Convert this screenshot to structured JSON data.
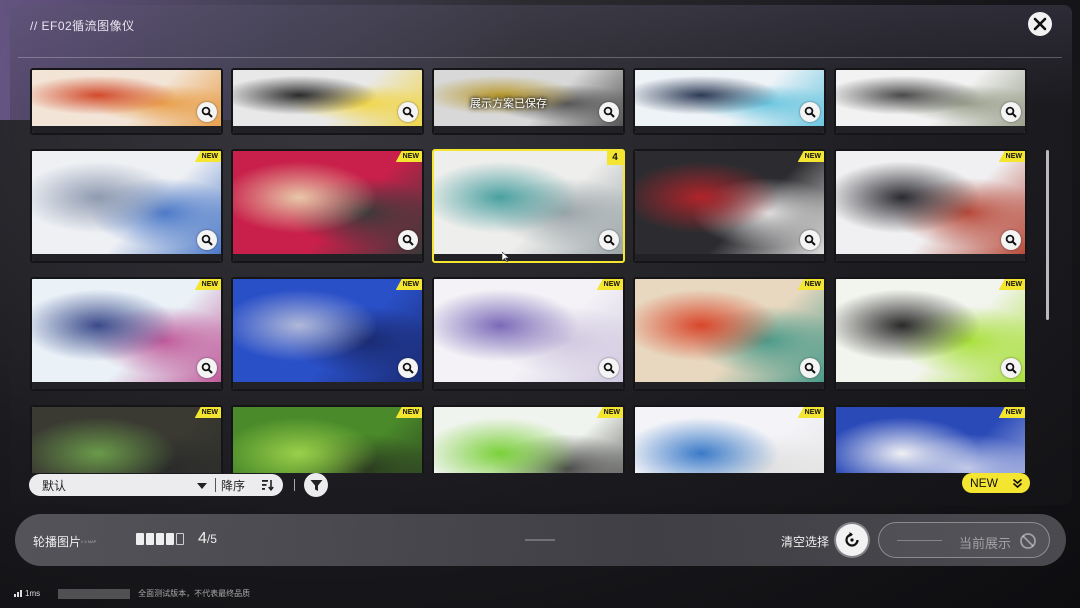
{
  "app": {
    "title": "// EF02循流图像仪"
  },
  "toast": "展示方案已保存",
  "grid": {
    "rows": [
      [
        {
          "badge": "",
          "colors": [
            "#f2e4d6",
            "#d24a2b",
            "#e9a04b"
          ]
        },
        {
          "badge": "",
          "colors": [
            "#e8e8e8",
            "#2b2b2b",
            "#f1d64a"
          ]
        },
        {
          "badge": "",
          "colors": [
            "#d8d8d8",
            "#b99a2e",
            "#555555"
          ]
        },
        {
          "badge": "",
          "colors": [
            "#eef3f7",
            "#2c3a55",
            "#6bc6e0"
          ]
        },
        {
          "badge": "",
          "colors": [
            "#f2f2f2",
            "#4a4a4a",
            "#9aa08c"
          ]
        }
      ],
      [
        {
          "badge": "NEW",
          "colors": [
            "#eef0f4",
            "#8e9ab0",
            "#4a78c8"
          ]
        },
        {
          "badge": "NEW",
          "colors": [
            "#c8204a",
            "#e8c8a8",
            "#3a3a3a"
          ]
        },
        {
          "badge": "4",
          "colors": [
            "#eeeeec",
            "#4aa0a0",
            "#9aa4a8"
          ],
          "selected": true
        },
        {
          "badge": "NEW",
          "colors": [
            "#2c2c30",
            "#b0242a",
            "#e0e0e0"
          ]
        },
        {
          "badge": "NEW",
          "colors": [
            "#f0f0f2",
            "#2a2a30",
            "#b84a3a"
          ]
        }
      ],
      [
        {
          "badge": "NEW",
          "colors": [
            "#eaf2f8",
            "#3a4a8a",
            "#c05a9a"
          ]
        },
        {
          "badge": "NEW",
          "colors": [
            "#2a50c8",
            "#b0b8d8",
            "#1a2a70"
          ]
        },
        {
          "badge": "NEW",
          "colors": [
            "#f4f2f6",
            "#7a6ab8",
            "#d0c8e0"
          ]
        },
        {
          "badge": "NEW",
          "colors": [
            "#e8d8c0",
            "#d8462a",
            "#4a9a8a"
          ]
        },
        {
          "badge": "NEW",
          "colors": [
            "#f2f4ee",
            "#2a2a2a",
            "#a8e03a"
          ]
        }
      ],
      [
        {
          "badge": "NEW",
          "colors": [
            "#3a3a32",
            "#6a9a4a",
            "#2a2a2a"
          ]
        },
        {
          "badge": "NEW",
          "colors": [
            "#4a8a2a",
            "#9ad04a",
            "#2a3a20"
          ]
        },
        {
          "badge": "NEW",
          "colors": [
            "#f0f4ee",
            "#7ad03a",
            "#4a4a4a"
          ]
        },
        {
          "badge": "NEW",
          "colors": [
            "#f4f4f8",
            "#3a7ac8",
            "#e0e0e0"
          ]
        },
        {
          "badge": "NEW",
          "colors": [
            "#2a4ab8",
            "#f0f0f4",
            "#c0c8e8"
          ]
        }
      ]
    ]
  },
  "sort": {
    "selected": "默认",
    "order_label": "降序"
  },
  "new_toggle": {
    "label": "NEW"
  },
  "bottom": {
    "carousel_label": "轮播图片",
    "carousel_sub": "// 4 MAP",
    "slots_filled": 4,
    "slots_total": 5,
    "count_current": "4",
    "count_total": "/5",
    "clear_label": "清空选择",
    "display_label": "当前展示"
  },
  "status": {
    "latency": "1ms",
    "note": "全面测试版本，不代表最终品质"
  },
  "colors": {
    "accent": "#f3e530",
    "panel_light": "#ecebee"
  }
}
